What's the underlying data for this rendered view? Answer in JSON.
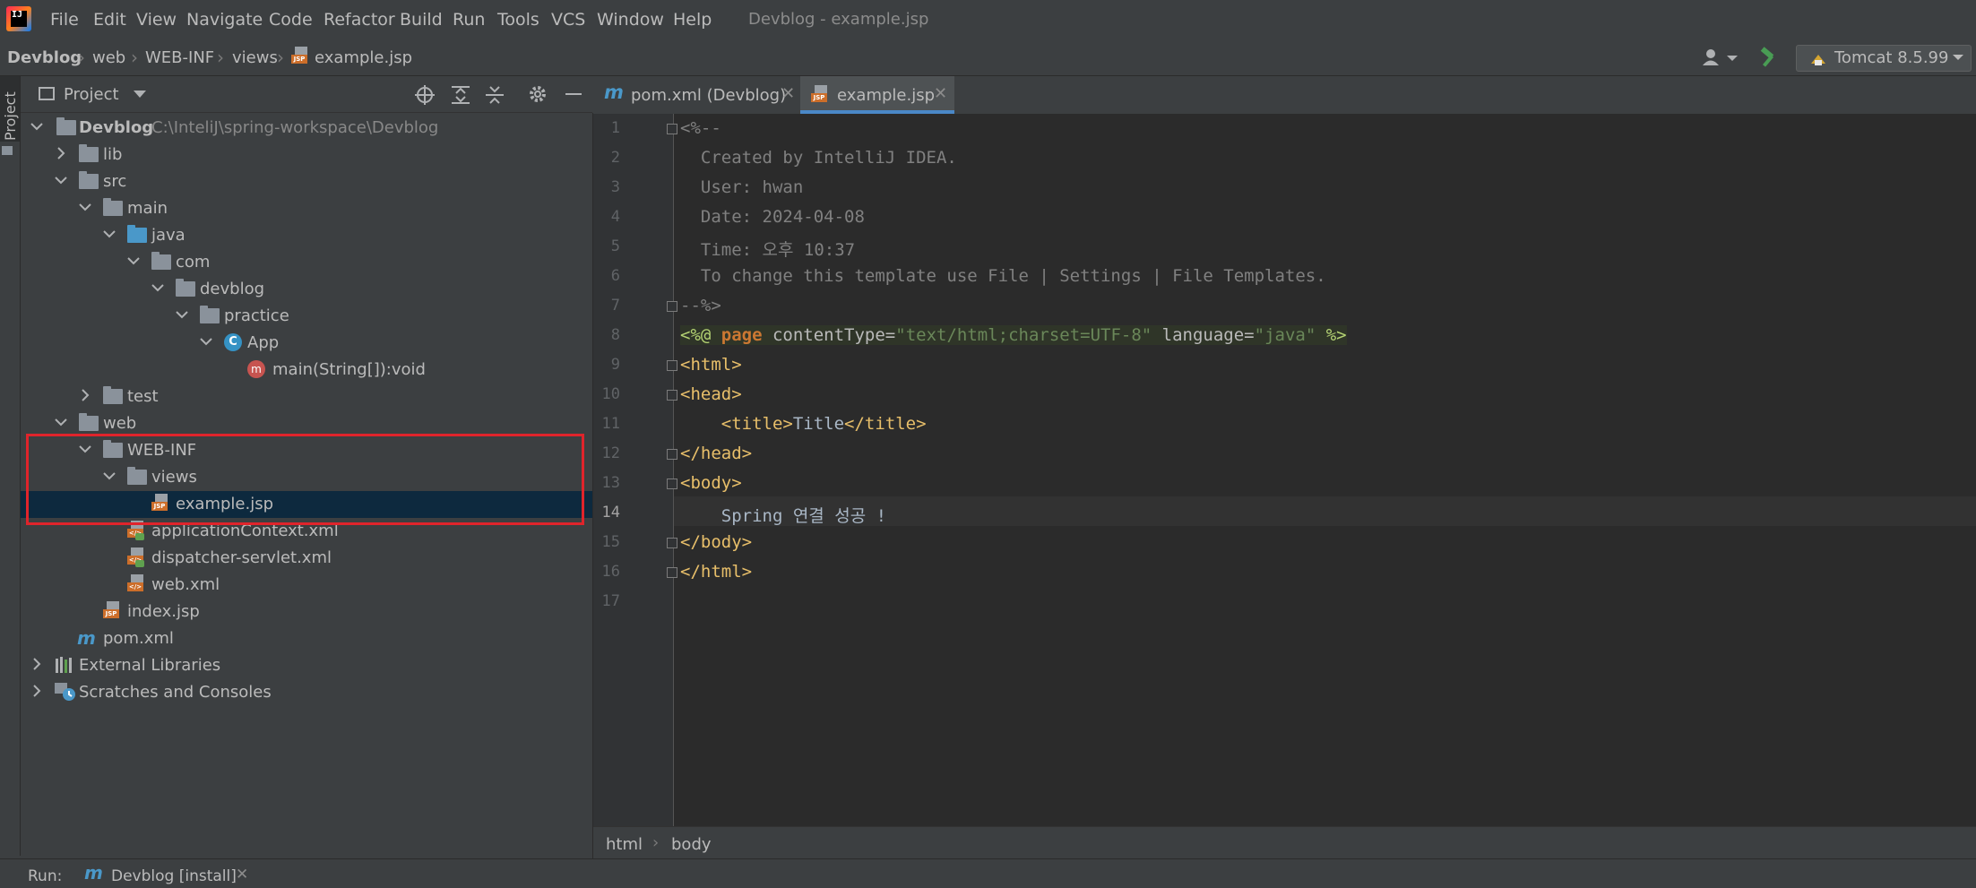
{
  "menubar": {
    "items": [
      "File",
      "Edit",
      "View",
      "Navigate",
      "Code",
      "Refactor",
      "Build",
      "Run",
      "Tools",
      "VCS",
      "Window",
      "Help"
    ],
    "window_title": "Devblog - example.jsp"
  },
  "navbar": {
    "crumbs": [
      "Devblog",
      "web",
      "WEB-INF",
      "views",
      "example.jsp"
    ],
    "run_config": "Tomcat 8.5.99"
  },
  "left_strip": {
    "project_label": "Project"
  },
  "project_panel": {
    "title": "Project",
    "root_path": "C:\\InteliJ\\spring-workspace\\Devblog",
    "tree": [
      {
        "label": "Devblog"
      },
      {
        "label": "lib"
      },
      {
        "label": "src"
      },
      {
        "label": "main"
      },
      {
        "label": "java"
      },
      {
        "label": "com"
      },
      {
        "label": "devblog"
      },
      {
        "label": "practice"
      },
      {
        "label": "App"
      },
      {
        "label": "main(String[]):void"
      },
      {
        "label": "test"
      },
      {
        "label": "web"
      },
      {
        "label": "WEB-INF"
      },
      {
        "label": "views"
      },
      {
        "label": "example.jsp"
      },
      {
        "label": "applicationContext.xml"
      },
      {
        "label": "dispatcher-servlet.xml"
      },
      {
        "label": "web.xml"
      },
      {
        "label": "index.jsp"
      },
      {
        "label": "pom.xml"
      },
      {
        "label": "External Libraries"
      },
      {
        "label": "Scratches and Consoles"
      }
    ]
  },
  "editor": {
    "tabs": [
      {
        "label": "pom.xml (Devblog)",
        "icon": "maven-icon"
      },
      {
        "label": "example.jsp",
        "icon": "jsp-icon"
      }
    ],
    "line_numbers": [
      "1",
      "2",
      "3",
      "4",
      "5",
      "6",
      "7",
      "8",
      "9",
      "10",
      "11",
      "12",
      "13",
      "14",
      "15",
      "16",
      "17"
    ],
    "lines": {
      "l1": "<%--",
      "l2": "  Created by IntelliJ IDEA.",
      "l3": "  User: hwan",
      "l4": "  Date: 2024-04-08",
      "l5": "  Time: 오후 10:37",
      "l6": "  To change this template use File | Settings | File Templates.",
      "l7": "--%>",
      "l8_open": "<%@ ",
      "l8_page": "page",
      "l8_attr1": " contentType=",
      "l8_val1": "\"text/html;charset=UTF-8\"",
      "l8_attr2": " language=",
      "l8_val2": "\"java\"",
      "l8_close": " %>",
      "l9": "<html>",
      "l10": "<head>",
      "l11_indent": "    ",
      "l11_open": "<title>",
      "l11_text": "Title",
      "l11_close": "</title>",
      "l12": "</head>",
      "l13": "<body>",
      "l14": "    Spring 연결 성공 !",
      "l15": "</body>",
      "l16": "</html>"
    },
    "breadcrumb": [
      "html",
      "body"
    ]
  },
  "runbar": {
    "label": "Run:",
    "config": "Devblog [install]"
  },
  "colors": {
    "accent": "#4a88c7",
    "highlight_box": "#e0242b",
    "selection": "#0d293e"
  }
}
